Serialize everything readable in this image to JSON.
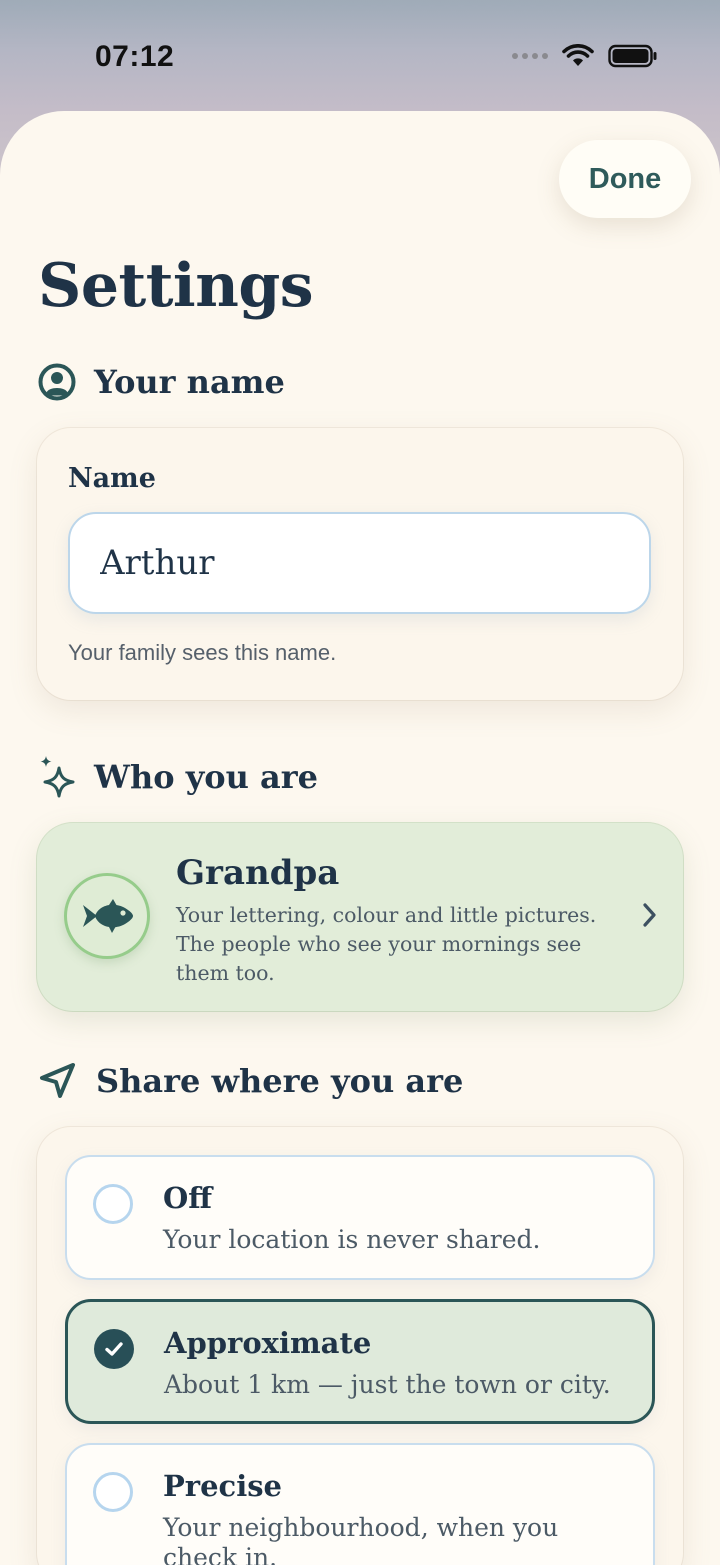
{
  "status_bar": {
    "time": "07:12"
  },
  "header": {
    "done_label": "Done",
    "title": "Settings"
  },
  "sections": {
    "your_name": {
      "heading": "Your name",
      "field_label": "Name",
      "value": "Arthur",
      "hint": "Your family sees this name."
    },
    "who_you_are": {
      "heading": "Who you are",
      "title": "Grandpa",
      "description": "Your lettering, colour and little pictures. The people who see your mornings see them too."
    },
    "share_location": {
      "heading": "Share where you are",
      "options": [
        {
          "title": "Off",
          "description": "Your location is never shared.",
          "selected": false
        },
        {
          "title": "Approximate",
          "description": "About 1 km — just the town or city.",
          "selected": true
        },
        {
          "title": "Precise",
          "description": "Your neighbourhood, when you check in.",
          "selected": false
        }
      ]
    }
  },
  "colors": {
    "accent": "#2b5657",
    "text": "#1f3347",
    "sheet_background": "#fdf8ef",
    "identity_card": "#e2edd9",
    "selected_option": "#dfeadb"
  },
  "icons": [
    "person-circle-icon",
    "sparkles-icon",
    "fish-icon",
    "chevron-right-icon",
    "location-arrow-icon",
    "checkmark-icon",
    "wifi-icon",
    "battery-icon"
  ]
}
